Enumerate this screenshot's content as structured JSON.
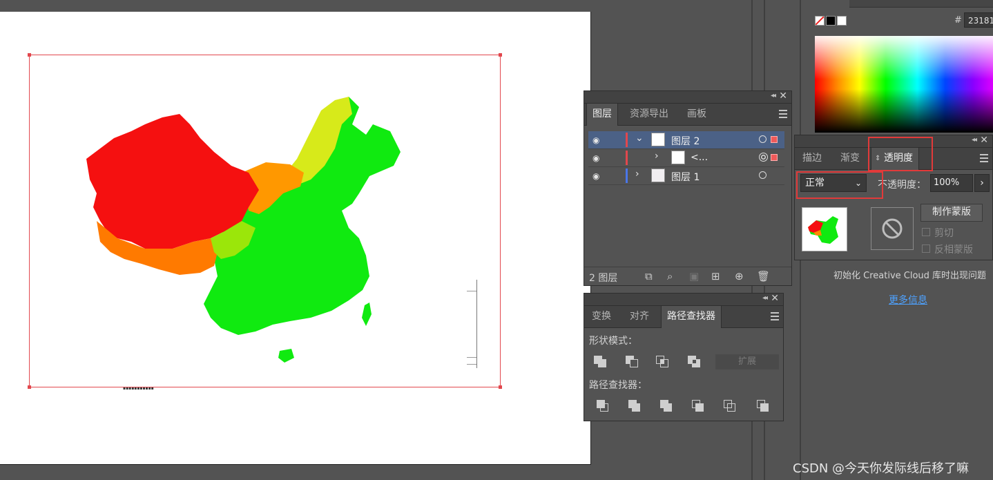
{
  "layers_panel": {
    "tabs": [
      "图层",
      "资源导出",
      "画板"
    ],
    "layers": [
      {
        "name": "图层 2",
        "expanded": true,
        "selected": true,
        "color": "#e2474d"
      },
      {
        "name": "<...",
        "sublayer": true,
        "color": "#e2474d"
      },
      {
        "name": "图层 1",
        "expanded": false,
        "color": "#4a76e8"
      }
    ],
    "footer_count": "2 图层"
  },
  "pathfinder_panel": {
    "tabs": [
      "变换",
      "对齐",
      "路径查找器"
    ],
    "shape_modes_label": "形状模式：",
    "pathfinders_label": "路径查找器：",
    "expand_label": "扩展"
  },
  "color_panel": {
    "hex_prefix": "#",
    "hex_value": "23181"
  },
  "transparency_panel": {
    "tabs": [
      "描边",
      "渐变",
      "透明度"
    ],
    "blend_mode": "正常",
    "opacity_label": "不透明度：",
    "opacity_value": "100%",
    "make_mask_label": "制作蒙版",
    "clip_label": "剪切",
    "invert_label": "反相蒙版"
  },
  "cc_message": "初始化 Creative Cloud 库时出现问题",
  "more_info": "更多信息",
  "watermark": "CSDN @今天你发际线后移了嘛",
  "colors": {
    "accent_red": "#e2474d",
    "selected_row": "#4b6186",
    "link": "#4ea2ff"
  }
}
